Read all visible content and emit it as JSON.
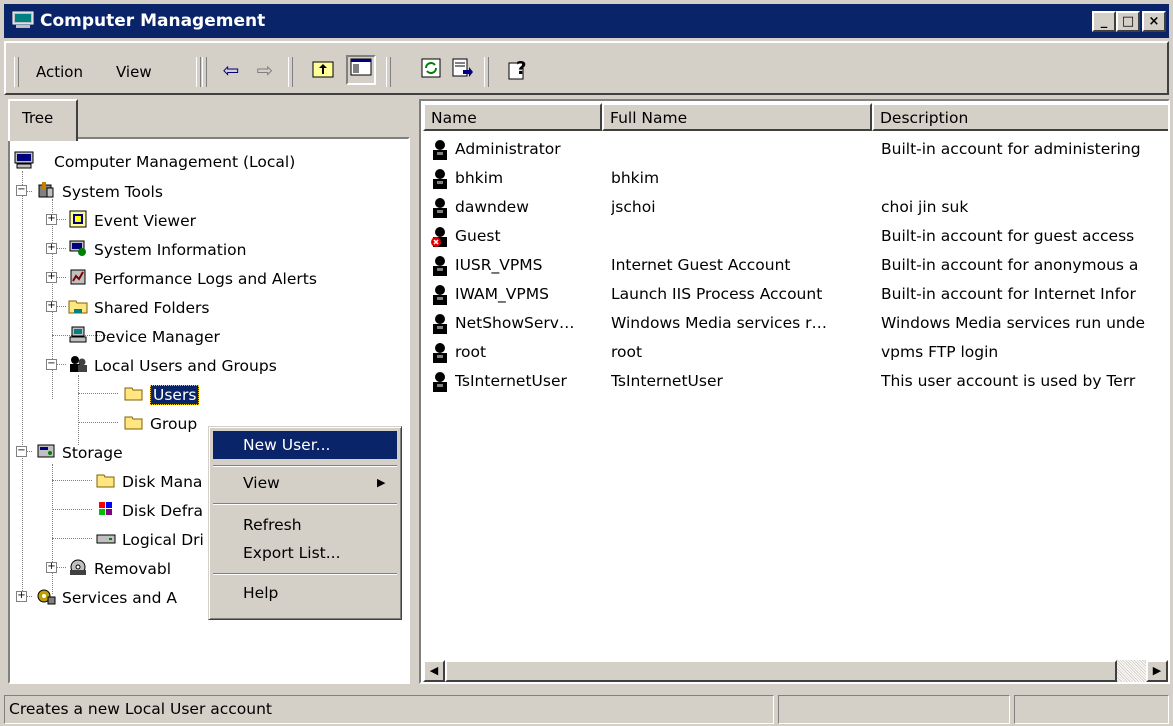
{
  "window": {
    "title": "Computer Management"
  },
  "caption_buttons": [
    "_",
    "□",
    "×"
  ],
  "menu": {
    "action": "Action",
    "view": "View"
  },
  "toolbar_icons": [
    "back-icon",
    "forward-icon",
    "up-folder-icon",
    "show-hide-tree-icon",
    "refresh-icon",
    "export-list-icon",
    "help-icon"
  ],
  "tree": {
    "tab": "Tree",
    "root": "Computer Management (Local)",
    "system_tools": "System Tools",
    "event_viewer": "Event Viewer",
    "system_information": "System Information",
    "perf_logs": "Performance Logs and Alerts",
    "shared_folders": "Shared Folders",
    "device_manager": "Device Manager",
    "local_users": "Local Users and Groups",
    "users": "Users",
    "groups": "Group",
    "storage": "Storage",
    "disk_mgmt": "Disk Mana",
    "disk_defrag": "Disk Defra",
    "logical_drives": "Logical Dri",
    "removable": "Removabl",
    "services": "Services and A"
  },
  "list": {
    "columns": [
      "Name",
      "Full Name",
      "Description"
    ],
    "rows": [
      {
        "name": "Administrator",
        "full": "",
        "desc": "Built-in account for administering",
        "disabled": false
      },
      {
        "name": "bhkim",
        "full": "bhkim",
        "desc": "",
        "disabled": false
      },
      {
        "name": "dawndew",
        "full": "jschoi",
        "desc": "choi jin suk",
        "disabled": false
      },
      {
        "name": "Guest",
        "full": "",
        "desc": "Built-in account for guest access",
        "disabled": true
      },
      {
        "name": "IUSR_VPMS",
        "full": "Internet Guest Account",
        "desc": "Built-in account for anonymous a",
        "disabled": false
      },
      {
        "name": "IWAM_VPMS",
        "full": "Launch IIS Process Account",
        "desc": "Built-in account for Internet Infor",
        "disabled": false
      },
      {
        "name": "NetShowServ…",
        "full": "Windows Media services r…",
        "desc": "Windows Media services run unde",
        "disabled": false
      },
      {
        "name": "root",
        "full": "root",
        "desc": "vpms FTP login",
        "disabled": false
      },
      {
        "name": "TsInternetUser",
        "full": "TsInternetUser",
        "desc": "This user account is used by Terr",
        "disabled": false
      }
    ]
  },
  "context_menu": {
    "new_user": "New User...",
    "view": "View",
    "refresh": "Refresh",
    "export_list": "Export List...",
    "help": "Help"
  },
  "status": {
    "text": "Creates a new Local User account"
  },
  "colors": {
    "title_bar": "#0a246a",
    "face": "#d4d0c8",
    "highlight": "#0a246a"
  }
}
